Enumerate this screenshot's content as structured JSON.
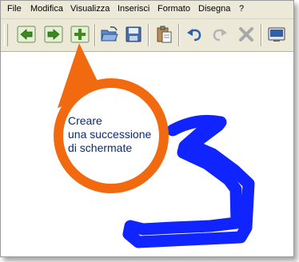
{
  "menu": {
    "file": "File",
    "modifica": "Modifica",
    "visualizza": "Visualizza",
    "inserisci": "Inserisci",
    "formato": "Formato",
    "disegna": "Disegna",
    "help": "?"
  },
  "toolbar": {
    "buttons": [
      {
        "icon": "back-arrow-icon"
      },
      {
        "icon": "forward-arrow-icon"
      },
      {
        "icon": "add-screen-icon"
      },
      {
        "icon": "open-folder-icon"
      },
      {
        "icon": "save-icon"
      },
      {
        "icon": "paste-icon"
      },
      {
        "icon": "undo-icon"
      },
      {
        "icon": "redo-icon"
      },
      {
        "icon": "delete-icon"
      },
      {
        "icon": "display-icon"
      }
    ]
  },
  "callout": {
    "line1": "Creare",
    "line2": "una successione",
    "line3": "di schermate"
  },
  "colors": {
    "menubar_bg": "#ece9d8",
    "callout_orange": "#f26a0f",
    "callout_text": "#0a2a7a",
    "drawing_blue": "#1024ff"
  }
}
